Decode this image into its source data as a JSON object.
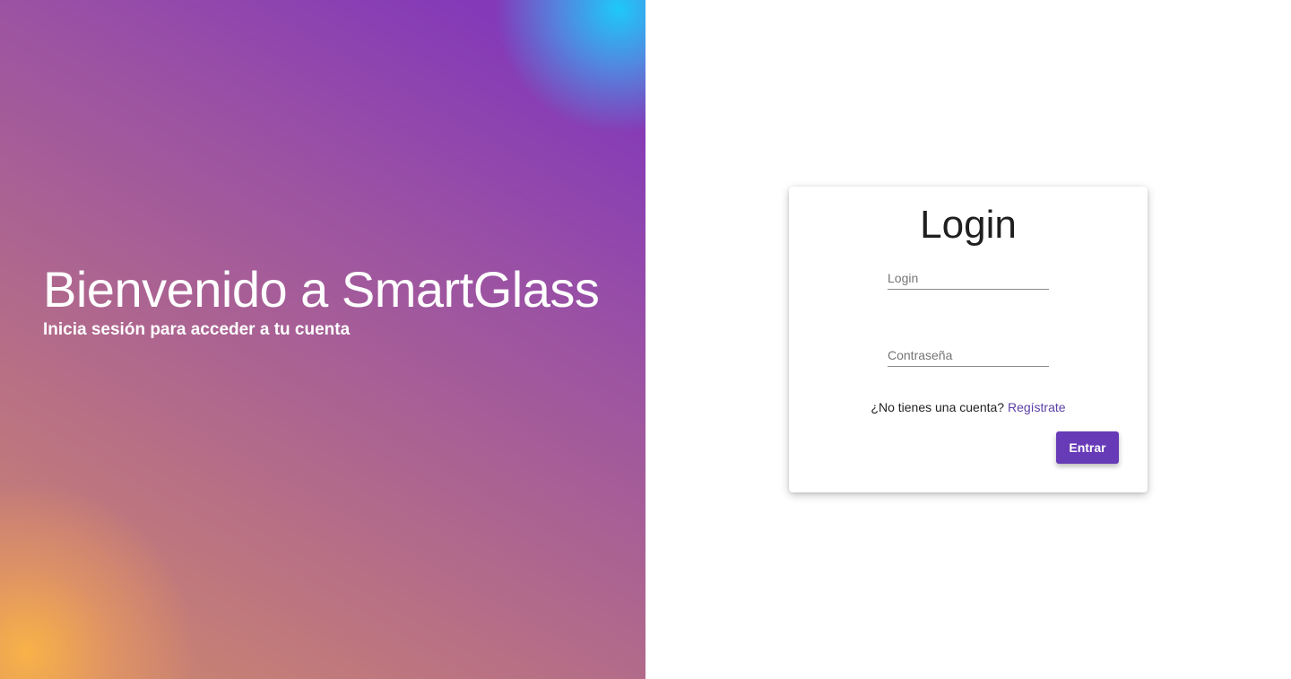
{
  "hero": {
    "title": "Bienvenido a SmartGlass",
    "subtitle": "Inicia sesión para acceder a tu cuenta"
  },
  "login_card": {
    "title": "Login",
    "login_placeholder": "Login",
    "password_placeholder": "Contraseña",
    "register_prompt": "¿No tienes una cuenta?",
    "register_link": "Regístrate",
    "submit_label": "Entrar"
  },
  "colors": {
    "accent": "#673ab7",
    "link": "#5a3fa5",
    "hero_gradient_start": "#f7b04a",
    "hero_gradient_mid": "#b36b8a",
    "hero_gradient_end": "#8439b8",
    "hero_corner_accent": "#1ec8fa"
  }
}
